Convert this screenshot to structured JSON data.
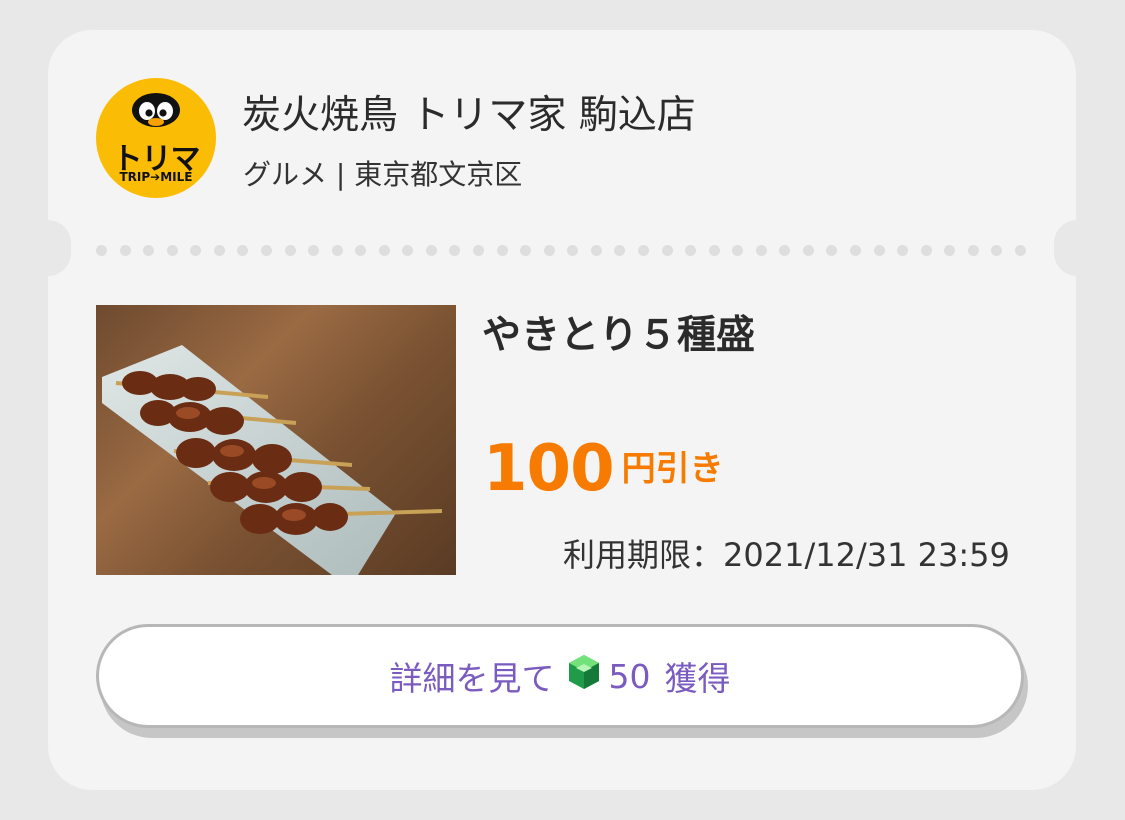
{
  "shop": {
    "logo_main": "トリマ",
    "logo_sub": "TRIP➔MILE",
    "name": "炭火焼鳥 トリマ家 駒込店",
    "meta": "グルメ | 東京都文京区"
  },
  "offer": {
    "title": "やきとり５種盛",
    "discount_amount": "100",
    "discount_unit": "円引き",
    "expiry": "利用期限：2021/12/31 23:59"
  },
  "action": {
    "label": "詳細を見て",
    "points": "50",
    "suffix": "獲得",
    "icon": "green-gem-icon"
  },
  "colors": {
    "accent_orange": "#f77b00",
    "button_text": "#7a5bc0",
    "logo_yellow": "#fbbc05"
  }
}
